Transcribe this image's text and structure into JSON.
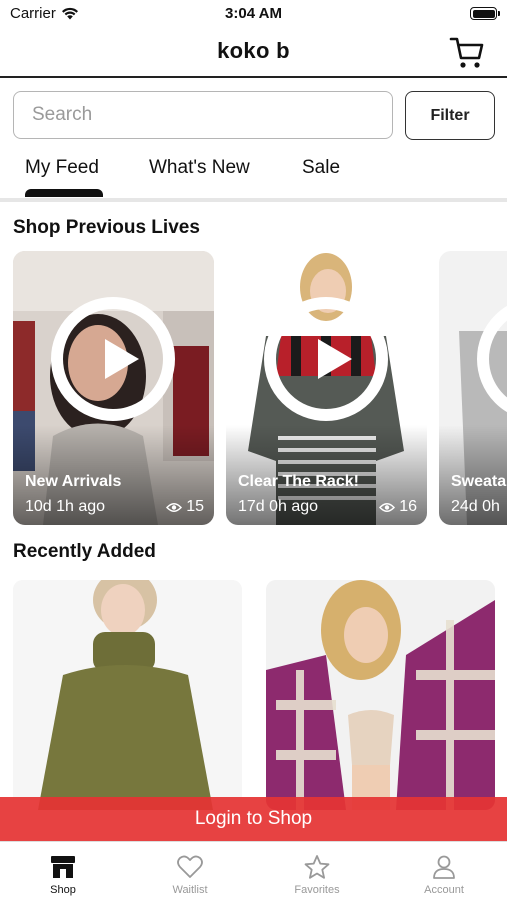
{
  "status_bar": {
    "carrier": "Carrier",
    "time": "3:04 AM"
  },
  "header": {
    "title": "koko b",
    "cart_icon": "cart-icon"
  },
  "search": {
    "placeholder": "Search",
    "filter_label": "Filter"
  },
  "tabs": [
    {
      "label": "My Feed",
      "active": true
    },
    {
      "label": "What's New",
      "active": false
    },
    {
      "label": "Sale",
      "active": false
    }
  ],
  "sections": {
    "previous_lives": "Shop Previous Lives",
    "recently_added": "Recently Added"
  },
  "previous_lives": [
    {
      "title": "New Arrivals",
      "ago": "10d 1h ago",
      "views": "15"
    },
    {
      "title": "Clear The Rack!",
      "ago": "17d 0h ago",
      "views": "16"
    },
    {
      "title": "Sweata",
      "ago": "24d 0h"
    }
  ],
  "recently_added": [
    {
      "icon": "olive-turtleneck-photo"
    },
    {
      "icon": "plaid-shacket-photo"
    }
  ],
  "login_banner": "Login to Shop",
  "bottom_tabs": [
    {
      "label": "Shop",
      "icon": "shop-icon",
      "active": true
    },
    {
      "label": "Waitlist",
      "icon": "heart-icon",
      "active": false
    },
    {
      "label": "Favorites",
      "icon": "star-icon",
      "active": false
    },
    {
      "label": "Account",
      "icon": "account-icon",
      "active": false
    }
  ],
  "colors": {
    "accent_red": "#e53434",
    "text": "#111111",
    "muted": "#999999"
  }
}
